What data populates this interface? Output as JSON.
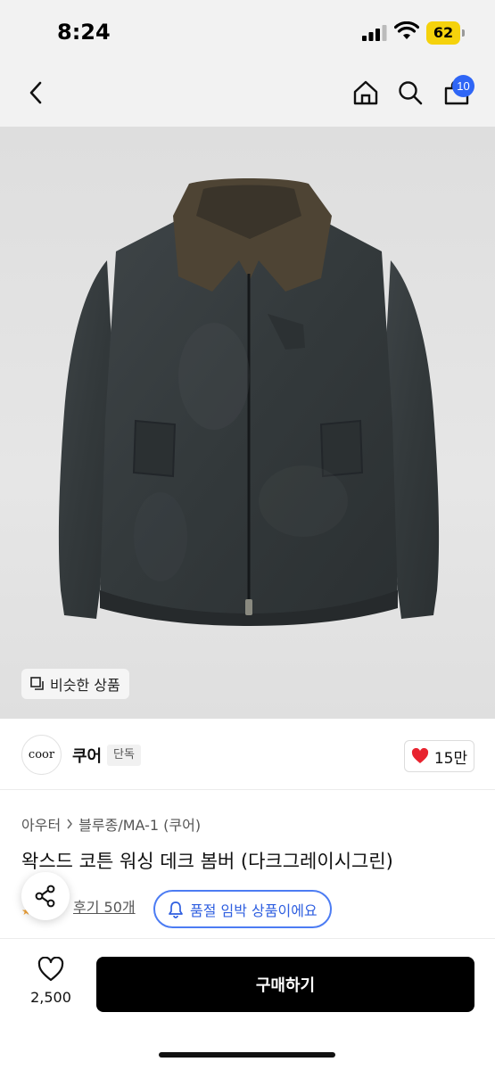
{
  "status_bar": {
    "time": "8:24",
    "battery": "62"
  },
  "nav": {
    "cart_count": "10"
  },
  "hero": {
    "similar_label": "비슷한 상품"
  },
  "brand": {
    "logo_text": "coor",
    "name": "쿠어",
    "tag": "단독",
    "likes": "15만"
  },
  "breadcrumb": {
    "category": "아우터",
    "subcategory": "블루종/MA-1 (쿠어)"
  },
  "product": {
    "title": "왁스드 코튼 워싱 데크 봄버 (다크그레이시그린)"
  },
  "review": {
    "link": "후기 50개",
    "stock_alert": "품절 임박 상품이에요"
  },
  "bottom": {
    "wish_count": "2,500",
    "buy_label": "구매하기"
  },
  "colors": {
    "accent_blue": "#2f66f6",
    "like_red": "#e8232f",
    "buy_black": "#000000"
  },
  "icons": [
    "back-icon",
    "home-icon",
    "search-icon",
    "cart-icon",
    "similar-icon",
    "heart-icon",
    "bell-icon",
    "share-icon",
    "wish-heart-icon"
  ]
}
